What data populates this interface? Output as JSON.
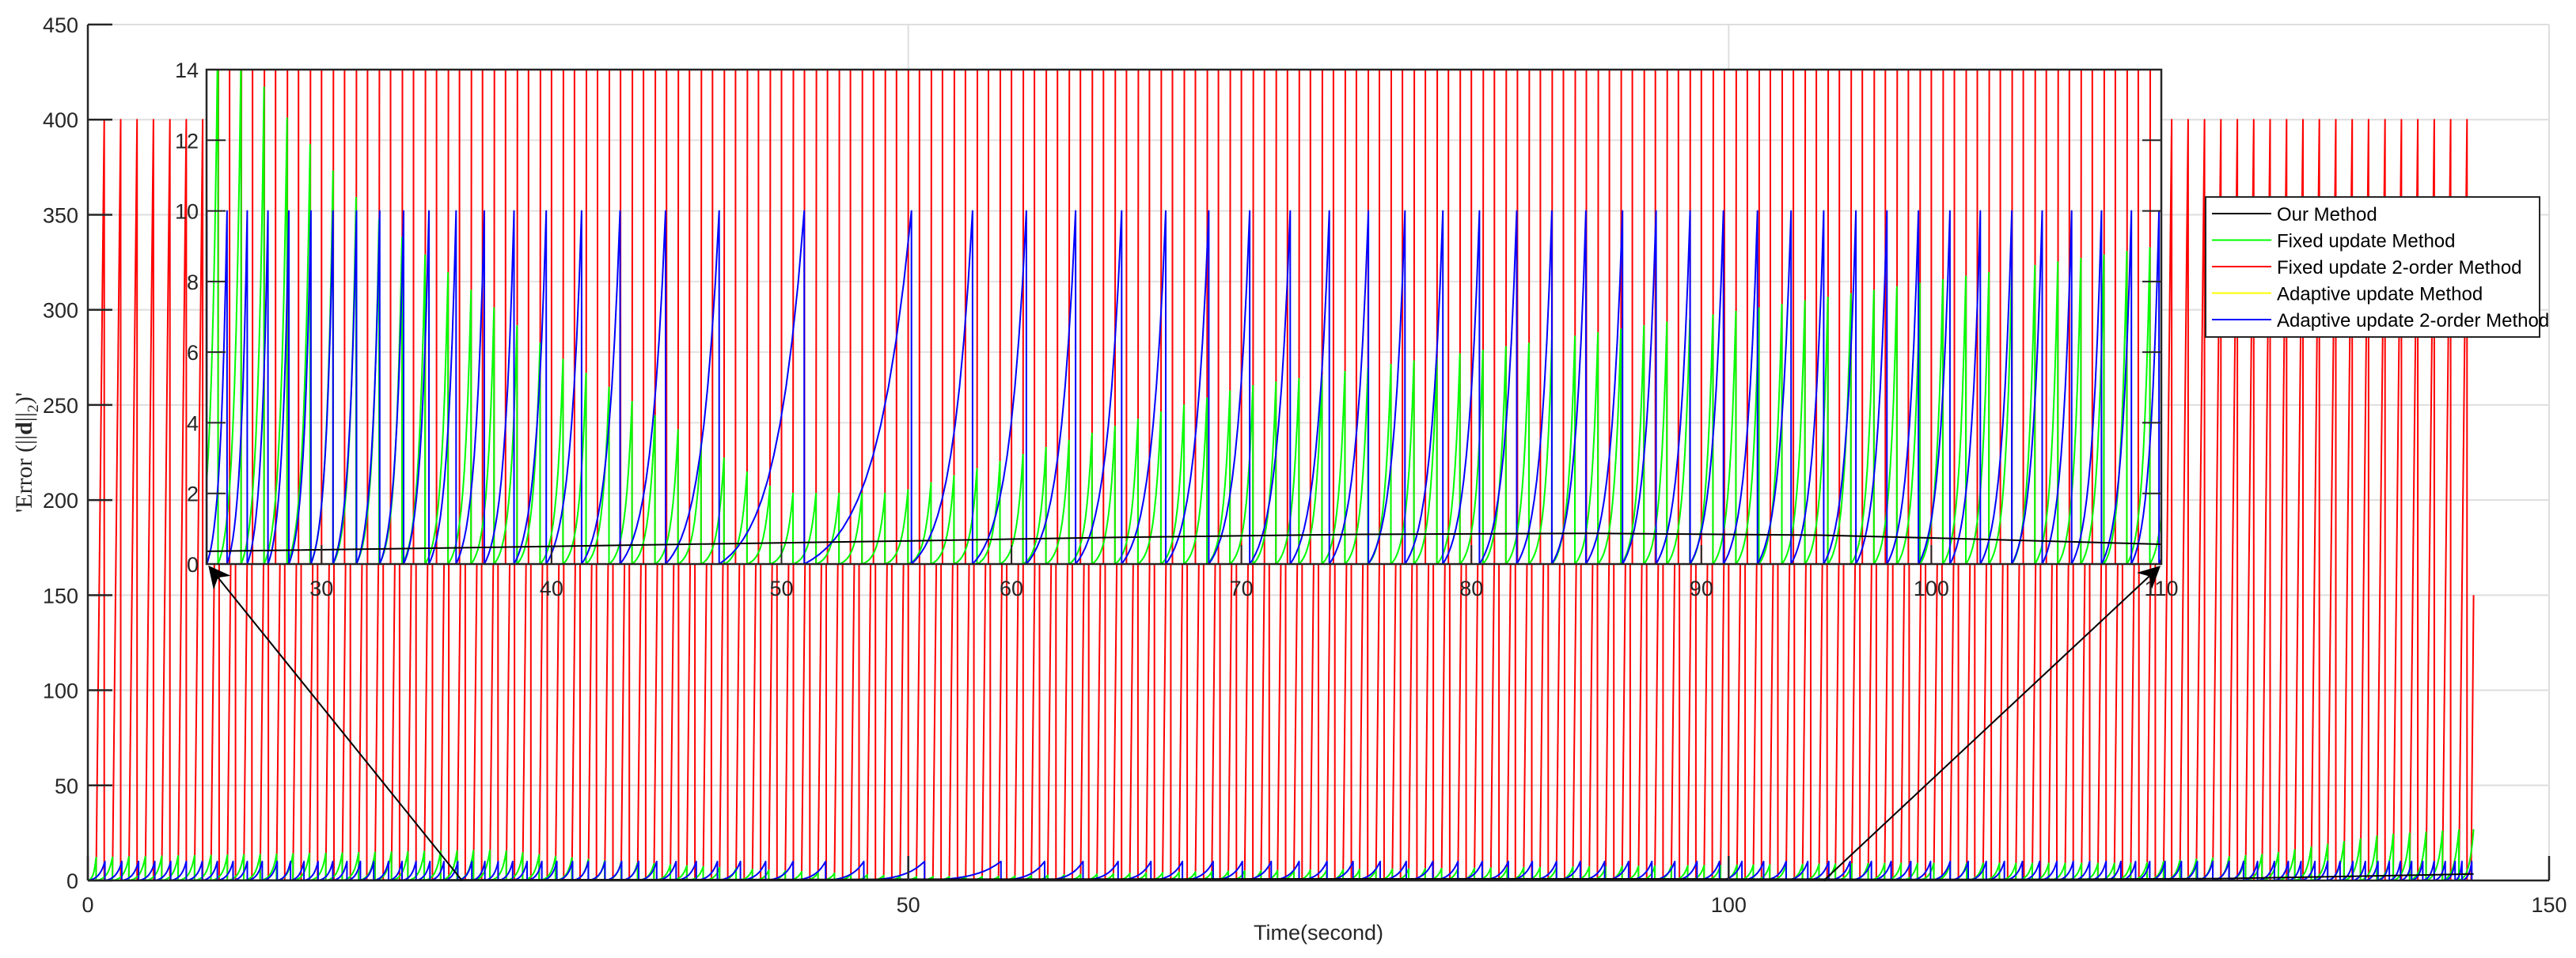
{
  "chart_data": {
    "type": "line",
    "title": "",
    "xlabel": "Time(second)",
    "ylabel": "'Error (||d||_2)'",
    "ylabel_parts": {
      "prefix": "'Error (||",
      "bold": "d",
      "mid": "||",
      "sub": "2",
      "suffix": ")'"
    },
    "grid": true,
    "main_axes": {
      "xlim": [
        0,
        150
      ],
      "ylim": [
        0,
        450
      ],
      "xticks": [
        0,
        50,
        100,
        150
      ],
      "yticks": [
        0,
        50,
        100,
        150,
        200,
        250,
        300,
        350,
        400,
        450
      ]
    },
    "inset_axes": {
      "description": "zoomed view",
      "xlim": [
        25,
        110
      ],
      "ylim": [
        0,
        14
      ],
      "xticks": [
        30,
        40,
        50,
        60,
        70,
        80,
        90,
        100,
        110
      ],
      "yticks": [
        0,
        2,
        4,
        6,
        8,
        10,
        12,
        14
      ]
    },
    "legend": {
      "placement": "right"
    },
    "series": [
      {
        "name": "Our Method",
        "color": "#000000",
        "kind": "points",
        "points": [
          [
            0,
            0
          ],
          [
            10,
            0.2
          ],
          [
            20,
            0.3
          ],
          [
            25,
            0.36
          ],
          [
            35,
            0.45
          ],
          [
            45,
            0.55
          ],
          [
            55,
            0.65
          ],
          [
            65,
            0.76
          ],
          [
            75,
            0.84
          ],
          [
            85,
            0.87
          ],
          [
            95,
            0.82
          ],
          [
            100,
            0.74
          ],
          [
            105,
            0.65
          ],
          [
            110,
            0.56
          ],
          [
            120,
            0.6
          ],
          [
            130,
            1.0
          ],
          [
            140,
            2.5
          ],
          [
            145.4,
            3.4
          ]
        ]
      },
      {
        "name": "Fixed update Method",
        "color": "#00ff00",
        "kind": "exp-periodic",
        "period": 1,
        "phase": 0.5,
        "end": 145.4,
        "amplitude": [
          [
            0,
            12
          ],
          [
            25,
            16
          ],
          [
            28,
            13
          ],
          [
            32,
            10
          ],
          [
            36,
            8
          ],
          [
            40,
            6
          ],
          [
            45,
            4
          ],
          [
            50,
            2
          ],
          [
            55,
            2
          ],
          [
            60,
            3
          ],
          [
            70,
            5
          ],
          [
            80,
            6
          ],
          [
            90,
            7
          ],
          [
            100,
            8
          ],
          [
            110,
            9
          ],
          [
            125,
            9
          ],
          [
            133,
            14
          ],
          [
            140,
            24
          ],
          [
            145.4,
            27
          ]
        ]
      },
      {
        "name": "Fixed update 2-order Method",
        "color": "#ff0000",
        "kind": "ramp",
        "period": 1,
        "first_peak": 1,
        "last_peak": 145,
        "peak": 400,
        "final": {
          "t": 145.4,
          "value": 150
        }
      },
      {
        "name": "Adaptive update Method",
        "color": "#ffff00",
        "kind": "points",
        "points": []
      },
      {
        "name": "Adaptive update 2-order Method",
        "color": "#0000ff",
        "kind": "exp-resets",
        "peak": 10,
        "resets": [
          0,
          1.04,
          2.07,
          3.09,
          4.08,
          5.05,
          6.0,
          6.97,
          7.89,
          8.85,
          9.72,
          10.63,
          11.54,
          12.35,
          13.17,
          14.03,
          14.93,
          15.79,
          16.61,
          17.42,
          18.33,
          19.15,
          20.0,
          20.85,
          21.7,
          22.55,
          23.4,
          24.2,
          25.01,
          25.89,
          26.77,
          27.67,
          28.58,
          29.54,
          30.5,
          31.52,
          32.53,
          33.57,
          34.67,
          35.85,
          37.08,
          38.37,
          39.77,
          41.31,
          42.98,
          44.96,
          47.29,
          50.99,
          55.65,
          58.31,
          60.65,
          62.79,
          64.79,
          66.71,
          68.58,
          70.36,
          72.12,
          73.82,
          75.52,
          77.11,
          78.76,
          80.35,
          81.97,
          83.5,
          84.98,
          86.57,
          88.03,
          89.51,
          90.96,
          92.44,
          93.9,
          95.32,
          96.72,
          98.07,
          99.44,
          100.81,
          102.13,
          103.5,
          104.82,
          106.1,
          107.4,
          108.7,
          109.9,
          111.1,
          112.3,
          113.5,
          114.6,
          115.7,
          116.8,
          117.9,
          118.95,
          120.0,
          121.0,
          122.0,
          123.0,
          123.9,
          124.8,
          125.66,
          126.6,
          127.59,
          128.56,
          129.5,
          130.49,
          131.38,
          132.23,
          133.26,
          134.11,
          134.88,
          135.73,
          136.5,
          137.26,
          138.04,
          138.8,
          139.57,
          140.26,
          140.94,
          141.62,
          142.3,
          142.99,
          143.67,
          144.27,
          144.69,
          145.29
        ]
      }
    ]
  }
}
